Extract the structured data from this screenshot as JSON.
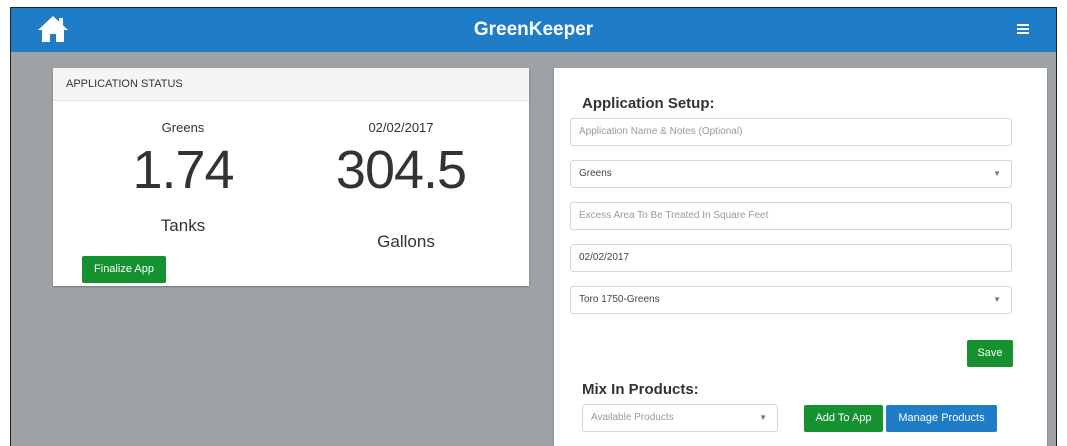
{
  "app": {
    "title": "GreenKeeper",
    "home_icon": "home-icon",
    "menu_icon": "hamburger-menu-icon",
    "brand_color": "#1f7cc7",
    "accent_green": "#159130"
  },
  "status": {
    "header": "APPLICATION STATUS",
    "area_label": "Greens",
    "date": "02/02/2017",
    "tanks_value": "1.74",
    "tanks_unit": "Tanks",
    "gallons_value": "304.5",
    "gallons_unit": "Gallons",
    "finalize_label": "Finalize App"
  },
  "setup": {
    "heading": "Application Setup:",
    "name_placeholder": "Application Name & Notes (Optional)",
    "area_selected": "Greens",
    "excess_placeholder": "Excess Area To Be Treated In Square Feet",
    "date_value": "02/02/2017",
    "sprayer_selected": "Toro 1750-Greens",
    "save_label": "Save"
  },
  "mix": {
    "heading": "Mix In Products:",
    "products_placeholder": "Available Products",
    "add_label": "Add To App",
    "manage_label": "Manage Products"
  }
}
